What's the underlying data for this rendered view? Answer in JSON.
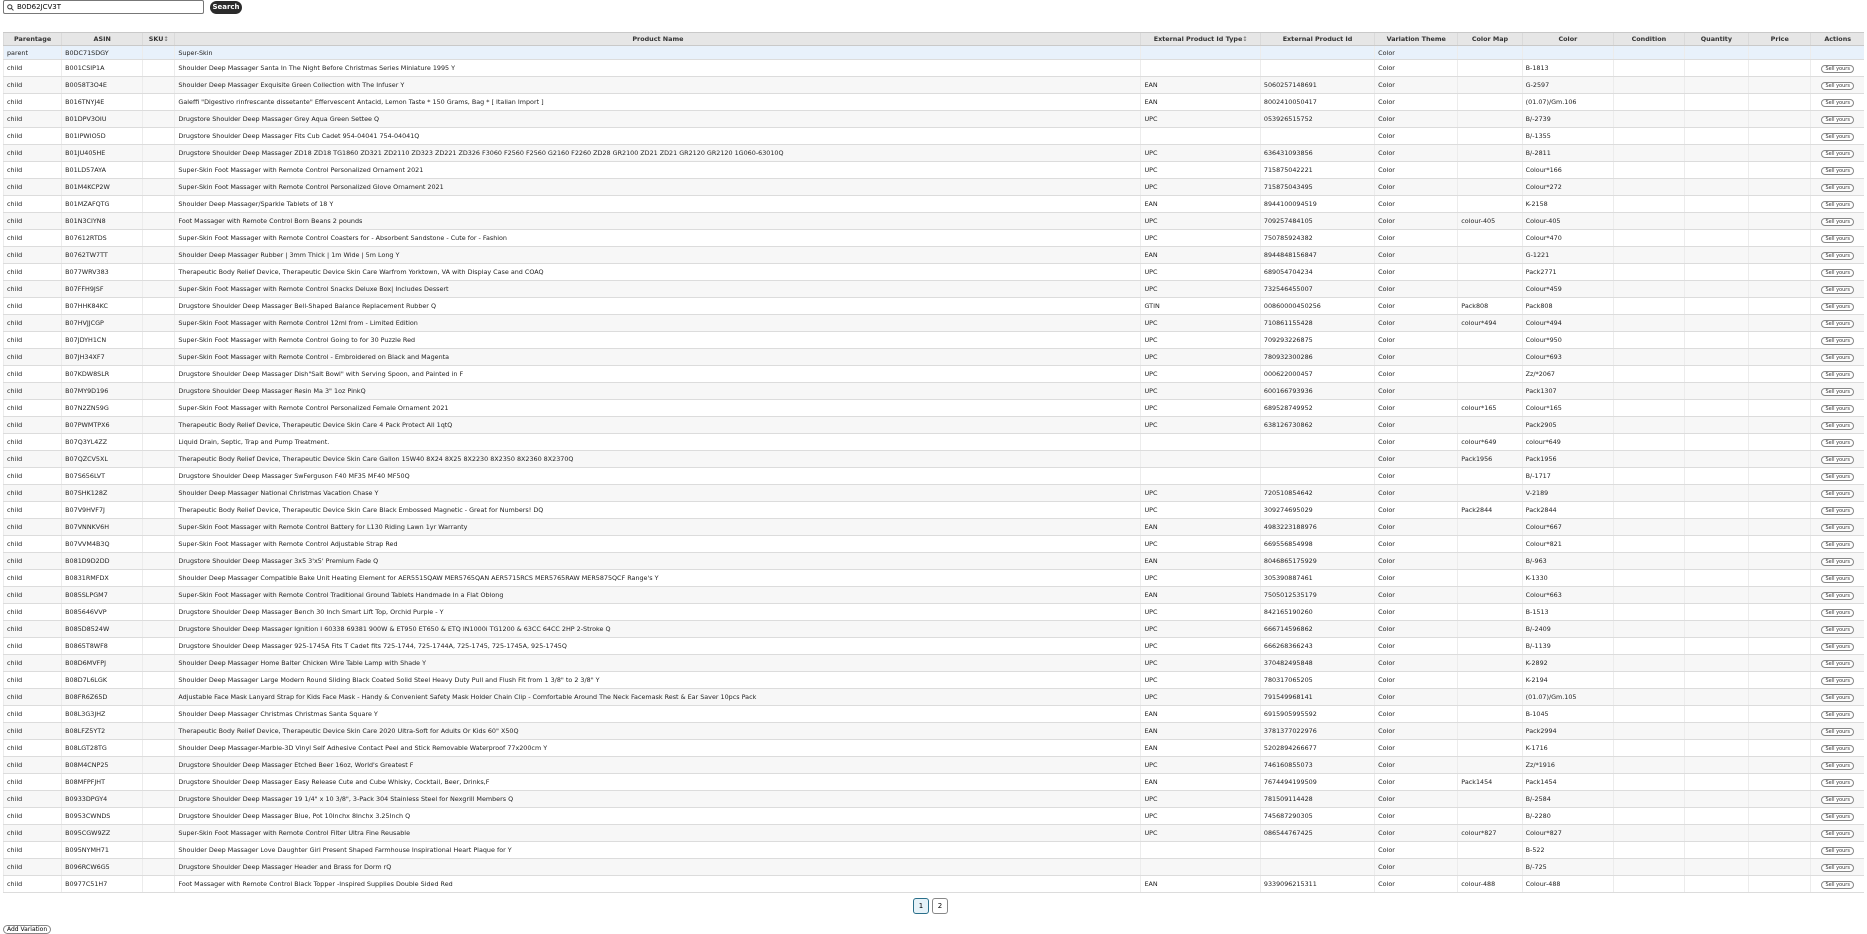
{
  "search": {
    "value": "B0D62JCV3T",
    "button_label": "Search"
  },
  "table": {
    "headers": [
      "Parentage",
      "ASIN",
      "SKU",
      "Product Name",
      "External Product Id Type",
      "External Product Id",
      "Variation Theme",
      "Color Map",
      "Color",
      "Condition",
      "Quantity",
      "Price",
      "Actions"
    ],
    "sort_glyph": "↕",
    "sell_label": "Sell yours",
    "rows": [
      [
        "parent",
        "B0DC71SDGY",
        "",
        "Super-Skin",
        "",
        "",
        "Color",
        "",
        "",
        "",
        "",
        "",
        ""
      ],
      [
        "child",
        "B001CSIP1A",
        "",
        "Shoulder Deep Massager Santa In The Night Before Christmas Series Miniature 1995 Y",
        "",
        "",
        "Color",
        "",
        "B-1813",
        "",
        "",
        "",
        "sell"
      ],
      [
        "child",
        "B0058T3O4E",
        "",
        "Shoulder Deep Massager Exquisite Green Collection with The Infuser Y",
        "EAN",
        "5060257148691",
        "Color",
        "",
        "G-2597",
        "",
        "",
        "",
        "sell"
      ],
      [
        "child",
        "B016TNYJ4E",
        "",
        "Galeffi \"Digestivo rinfrescante dissetante\" Effervescent Antacid, Lemon Taste * 150 Grams, Bag * [ Italian Import ]",
        "EAN",
        "8002410050417",
        "Color",
        "",
        "(01.07)/Gm.106",
        "",
        "",
        "",
        "sell"
      ],
      [
        "child",
        "B01DPV3OIU",
        "",
        "Drugstore Shoulder Deep Massager Grey Aqua Green Settee Q",
        "UPC",
        "053926515752",
        "Color",
        "",
        "B/-2739",
        "",
        "",
        "",
        "sell"
      ],
      [
        "child",
        "B01IPWIO5D",
        "",
        "Drugstore Shoulder Deep Massager Fits Cub Cadet 954-04041 754-04041Q",
        "",
        "",
        "Color",
        "",
        "B/-1355",
        "",
        "",
        "",
        "sell"
      ],
      [
        "child",
        "B01JU405HE",
        "",
        "Drugstore Shoulder Deep Massager ZD18 ZD18 TG1860 ZD321 ZD2110 ZD323 ZD221 ZD326 F3060 F2560 F2560 G2160 F2260 ZD28 GR2100 ZD21 ZD21 GR2120 GR2120 1G060-63010Q",
        "UPC",
        "636431093856",
        "Color",
        "",
        "B/-2811",
        "",
        "",
        "",
        "sell"
      ],
      [
        "child",
        "B01LD57AYA",
        "",
        "Super-Skin Foot Massager with Remote Control Personalized Ornament 2021",
        "UPC",
        "715875042221",
        "Color",
        "",
        "Colour*166",
        "",
        "",
        "",
        "sell"
      ],
      [
        "child",
        "B01M4KCP2W",
        "",
        "Super-Skin Foot Massager with Remote Control Personalized Glove Ornament 2021",
        "UPC",
        "715875043495",
        "Color",
        "",
        "Colour*272",
        "",
        "",
        "",
        "sell"
      ],
      [
        "child",
        "B01MZAFQTG",
        "",
        "Shoulder Deep Massager/Sparkle Tablets of 18 Y",
        "EAN",
        "8944100094519",
        "Color",
        "",
        "K-2158",
        "",
        "",
        "",
        "sell"
      ],
      [
        "child",
        "B01N3CIYN8",
        "",
        "Foot Massager with Remote Control Born Beans 2 pounds",
        "UPC",
        "709257484105",
        "Color",
        "colour-405",
        "Colour-405",
        "",
        "",
        "",
        "sell"
      ],
      [
        "child",
        "B07612RTDS",
        "",
        "Super-Skin Foot Massager with Remote Control Coasters for - Absorbent Sandstone - Cute for - Fashion",
        "UPC",
        "750785924382",
        "Color",
        "",
        "Colour*470",
        "",
        "",
        "",
        "sell"
      ],
      [
        "child",
        "B0762TW7TT",
        "",
        "Shoulder Deep Massager Rubber | 3mm Thick | 1m Wide | 5m Long Y",
        "EAN",
        "8944848156847",
        "Color",
        "",
        "G-1221",
        "",
        "",
        "",
        "sell"
      ],
      [
        "child",
        "B077WRV383",
        "",
        "Therapeutic Body Relief Device, Therapeutic Device Skin Care Warfrom Yorktown, VA with Display Case and COAQ",
        "UPC",
        "689054704234",
        "Color",
        "",
        "Pack2771",
        "",
        "",
        "",
        "sell"
      ],
      [
        "child",
        "B07FFH9JSF",
        "",
        "Super-Skin Foot Massager with Remote Control Snacks Deluxe Box| Includes Dessert",
        "UPC",
        "732546455007",
        "Color",
        "",
        "Colour*459",
        "",
        "",
        "",
        "sell"
      ],
      [
        "child",
        "B07HHK84KC",
        "",
        "Drugstore Shoulder Deep Massager Bell-Shaped Balance Replacement Rubber Q",
        "GTIN",
        "00860000450256",
        "Color",
        "Pack808",
        "Pack808",
        "",
        "",
        "",
        "sell"
      ],
      [
        "child",
        "B07HVJJCGP",
        "",
        "Super-Skin Foot Massager with Remote Control 12ml from - Limited Edition",
        "UPC",
        "710861155428",
        "Color",
        "colour*494",
        "Colour*494",
        "",
        "",
        "",
        "sell"
      ],
      [
        "child",
        "B07JDYH1CN",
        "",
        "Super-Skin Foot Massager with Remote Control Going to for 30 Puzzle Red",
        "UPC",
        "709293226875",
        "Color",
        "",
        "Colour*950",
        "",
        "",
        "",
        "sell"
      ],
      [
        "child",
        "B07JH34XF7",
        "",
        "Super-Skin Foot Massager with Remote Control - Embroidered on Black and Magenta",
        "UPC",
        "780932300286",
        "Color",
        "",
        "Colour*693",
        "",
        "",
        "",
        "sell"
      ],
      [
        "child",
        "B07KDW8SLR",
        "",
        "Drugstore Shoulder Deep Massager Dish\"Salt Bowl\" with Serving Spoon, and Painted in F",
        "UPC",
        "000622000457",
        "Color",
        "",
        "Zz/*2067",
        "",
        "",
        "",
        "sell"
      ],
      [
        "child",
        "B07MY9D196",
        "",
        "Drugstore Shoulder Deep Massager Resin Ma 3\" 1oz PinkQ",
        "UPC",
        "600166793936",
        "Color",
        "",
        "Pack1307",
        "",
        "",
        "",
        "sell"
      ],
      [
        "child",
        "B07N2ZN59G",
        "",
        "Super-Skin Foot Massager with Remote Control Personalized Female Ornament 2021",
        "UPC",
        "689528749952",
        "Color",
        "colour*165",
        "Colour*165",
        "",
        "",
        "",
        "sell"
      ],
      [
        "child",
        "B07PWMTPX6",
        "",
        "Therapeutic Body Relief Device, Therapeutic Device Skin Care 4 Pack Protect All 1qtQ",
        "UPC",
        "638126730862",
        "Color",
        "",
        "Pack2905",
        "",
        "",
        "",
        "sell"
      ],
      [
        "child",
        "B07Q3YL4ZZ",
        "",
        "Liquid Drain, Septic, Trap and Pump Treatment.",
        "",
        "",
        "Color",
        "colour*649",
        "colour*649",
        "",
        "",
        "",
        "sell"
      ],
      [
        "child",
        "B07QZCV5XL",
        "",
        "Therapeutic Body Relief Device, Therapeutic Device Skin Care Gallon 15W40 8X24 8X25 8X2230 8X2350 8X2360 8X2370Q",
        "",
        "",
        "Color",
        "Pack1956",
        "Pack1956",
        "",
        "",
        "",
        "sell"
      ],
      [
        "child",
        "B07S656LVT",
        "",
        "Drugstore Shoulder Deep Massager SwFerguson F40 MF35 MF40 MF50Q",
        "",
        "",
        "Color",
        "",
        "B/-1717",
        "",
        "",
        "",
        "sell"
      ],
      [
        "child",
        "B07SHK128Z",
        "",
        "Shoulder Deep Massager National Christmas Vacation Chase Y",
        "UPC",
        "720510854642",
        "Color",
        "",
        "V-2189",
        "",
        "",
        "",
        "sell"
      ],
      [
        "child",
        "B07V9HVF7J",
        "",
        "Therapeutic Body Relief Device, Therapeutic Device Skin Care Black Embossed Magnetic - Great for Numbers! DQ",
        "UPC",
        "309274695029",
        "Color",
        "Pack2844",
        "Pack2844",
        "",
        "",
        "",
        "sell"
      ],
      [
        "child",
        "B07VNNKV6H",
        "",
        "Super-Skin Foot Massager with Remote Control Battery for L130 Riding Lawn 1yr Warranty",
        "EAN",
        "4983223188976",
        "Color",
        "",
        "Colour*667",
        "",
        "",
        "",
        "sell"
      ],
      [
        "child",
        "B07VVM4B3Q",
        "",
        "Super-Skin Foot Massager with Remote Control Adjustable Strap Red",
        "UPC",
        "669556854998",
        "Color",
        "",
        "Colour*821",
        "",
        "",
        "",
        "sell"
      ],
      [
        "child",
        "B081D9D2DD",
        "",
        "Drugstore Shoulder Deep Massager 3x5 3'x5' Premium Fade Q",
        "EAN",
        "8046865175929",
        "Color",
        "",
        "B/-963",
        "",
        "",
        "",
        "sell"
      ],
      [
        "child",
        "B0831RMFDX",
        "",
        "Shoulder Deep Massager Compatible Bake Unit Heating Element for AER5515QAW MER5765QAN AER5715RCS MER5765RAW MER5875QCF Range's Y",
        "UPC",
        "305390887461",
        "Color",
        "",
        "K-1330",
        "",
        "",
        "",
        "sell"
      ],
      [
        "child",
        "B085SLPGM7",
        "",
        "Super-Skin Foot Massager with Remote Control Traditional Ground Tablets Handmade In a Flat Oblong",
        "EAN",
        "7505012535179",
        "Color",
        "",
        "Colour*663",
        "",
        "",
        "",
        "sell"
      ],
      [
        "child",
        "B085646VVP",
        "",
        "Drugstore Shoulder Deep Massager Bench 30 Inch Smart Lift Top, Orchid Purple - Y",
        "UPC",
        "842165190260",
        "Color",
        "",
        "B-1513",
        "",
        "",
        "",
        "sell"
      ],
      [
        "child",
        "B085D8524W",
        "",
        "Drugstore Shoulder Deep Massager Ignition I 60338 69381 900W & ET950 ET650 & ETQ IN1000i TG1200 & 63CC 64CC 2HP 2-Stroke Q",
        "UPC",
        "666714596862",
        "Color",
        "",
        "B/-2409",
        "",
        "",
        "",
        "sell"
      ],
      [
        "child",
        "B0865T8WF8",
        "",
        "Drugstore Shoulder Deep Massager 925-1745A Fits T Cadet fits 725-1744, 725-1744A, 725-1745, 725-1745A, 925-1745Q",
        "UPC",
        "666268366243",
        "Color",
        "",
        "B/-1139",
        "",
        "",
        "",
        "sell"
      ],
      [
        "child",
        "B08D6MVFPJ",
        "",
        "Shoulder Deep Massager Home Balter Chicken Wire Table Lamp with Shade Y",
        "UPC",
        "370482495848",
        "Color",
        "",
        "K-2892",
        "",
        "",
        "",
        "sell"
      ],
      [
        "child",
        "B08D7L6LGK",
        "",
        "Shoulder Deep Massager Large Modern Round Sliding Black Coated Solid Steel Heavy Duty Pull and Flush Fit from 1 3/8\" to 2 3/8\" Y",
        "UPC",
        "780317065205",
        "Color",
        "",
        "K-2194",
        "",
        "",
        "",
        "sell"
      ],
      [
        "child",
        "B08FR6Z65D",
        "",
        "Adjustable Face Mask Lanyard Strap for Kids Face Mask - Handy & Convenient Safety Mask Holder Chain Clip - Comfortable Around The Neck Facemask Rest & Ear Saver 10pcs Pack",
        "UPC",
        "791549968141",
        "Color",
        "",
        "(01.07)/Gm.105",
        "",
        "",
        "",
        "sell"
      ],
      [
        "child",
        "B08L3G3JHZ",
        "",
        "Shoulder Deep Massager Christmas Christmas Santa Square Y",
        "EAN",
        "6915905995592",
        "Color",
        "",
        "B-1045",
        "",
        "",
        "",
        "sell"
      ],
      [
        "child",
        "B08LFZ5YT2",
        "",
        "Therapeutic Body Relief Device, Therapeutic Device Skin Care 2020 Ultra-Soft for Adults Or Kids 60\" X50Q",
        "EAN",
        "3781377022976",
        "Color",
        "",
        "Pack2994",
        "",
        "",
        "",
        "sell"
      ],
      [
        "child",
        "B08LGT28TG",
        "",
        "Shoulder Deep Massager-Marble-3D Vinyl Self Adhesive Contact Peel and Stick Removable Waterproof 77x200cm Y",
        "EAN",
        "5202894266677",
        "Color",
        "",
        "K-1716",
        "",
        "",
        "",
        "sell"
      ],
      [
        "child",
        "B08M4CNP25",
        "",
        "Drugstore Shoulder Deep Massager Etched Beer 16oz, World's Greatest F",
        "UPC",
        "746160855073",
        "Color",
        "",
        "Zz/*1916",
        "",
        "",
        "",
        "sell"
      ],
      [
        "child",
        "B08MFPFJHT",
        "",
        "Drugstore Shoulder Deep Massager Easy Release Cute and Cube Whisky, Cocktail, Beer, Drinks,F",
        "EAN",
        "7674494199509",
        "Color",
        "Pack1454",
        "Pack1454",
        "",
        "",
        "",
        "sell"
      ],
      [
        "child",
        "B0933DPGY4",
        "",
        "Drugstore Shoulder Deep Massager 19 1/4\" x 10 3/8\", 3-Pack 304 Stainless Steel for Nexgrill Members Q",
        "UPC",
        "781509114428",
        "Color",
        "",
        "B/-2584",
        "",
        "",
        "",
        "sell"
      ],
      [
        "child",
        "B0953CWNDS",
        "",
        "Drugstore Shoulder Deep Massager Blue, Pot 10Inchx 8Inchx 3.25Inch Q",
        "UPC",
        "745687290305",
        "Color",
        "",
        "B/-2280",
        "",
        "",
        "",
        "sell"
      ],
      [
        "child",
        "B095CGW9ZZ",
        "",
        "Super-Skin Foot Massager with Remote Control Filter Ultra Fine Reusable",
        "UPC",
        "086544767425",
        "Color",
        "colour*827",
        "Colour*827",
        "",
        "",
        "",
        "sell"
      ],
      [
        "child",
        "B095NYMH71",
        "",
        "Shoulder Deep Massager Love Daughter Girl Present Shaped Farmhouse Inspirational Heart Plaque for Y",
        "",
        "",
        "Color",
        "",
        "B-522",
        "",
        "",
        "",
        "sell"
      ],
      [
        "child",
        "B096RCW6G5",
        "",
        "Drugstore Shoulder Deep Massager Header and Brass for Dorm rQ",
        "",
        "",
        "Color",
        "",
        "B/-725",
        "",
        "",
        "",
        "sell"
      ],
      [
        "child",
        "B0977C51H7",
        "",
        "Foot Massager with Remote Control Black Topper -Inspired Supplies Double Sided Red",
        "EAN",
        "9339096215311",
        "Color",
        "colour-488",
        "Colour-488",
        "",
        "",
        "",
        "sell"
      ]
    ]
  },
  "pagination": {
    "pages": [
      "1",
      "2"
    ],
    "active": "1"
  },
  "add_variation_label": "Add Variation"
}
